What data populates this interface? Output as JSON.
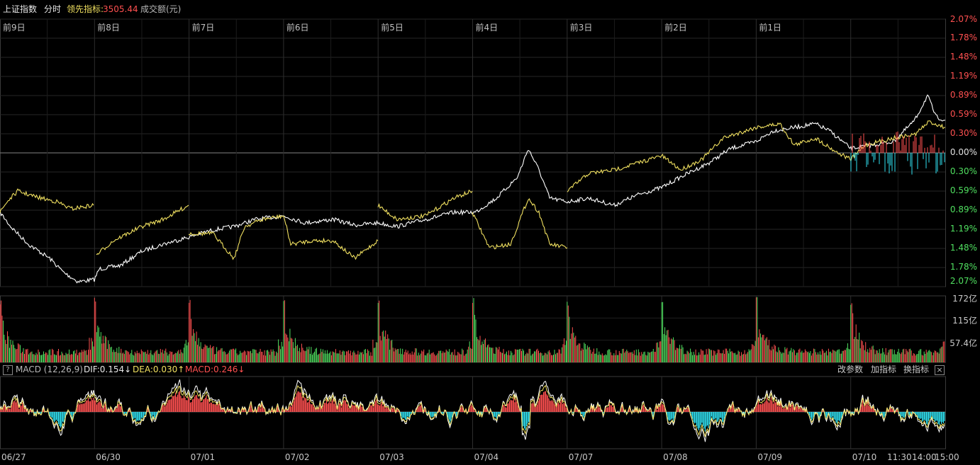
{
  "header": {
    "index_name": "上证指数",
    "mode": "分时",
    "lead_label": "领先指标:",
    "lead_value": "3505.44",
    "volume_unit": "成交额(元)"
  },
  "day_labels": [
    "前9日",
    "前8日",
    "前7日",
    "前6日",
    "前5日",
    "前4日",
    "前3日",
    "前2日",
    "前1日"
  ],
  "pct_labels": [
    {
      "text": "2.07%",
      "color": "#ff5050"
    },
    {
      "text": "1.78%",
      "color": "#ff5050"
    },
    {
      "text": "1.48%",
      "color": "#ff5050"
    },
    {
      "text": "1.19%",
      "color": "#ff5050"
    },
    {
      "text": "0.89%",
      "color": "#ff5050"
    },
    {
      "text": "0.59%",
      "color": "#ff5050"
    },
    {
      "text": "0.30%",
      "color": "#ff5050"
    },
    {
      "text": "0.00%",
      "color": "#e0e0e0"
    },
    {
      "text": "0.30%",
      "color": "#50e060"
    },
    {
      "text": "0.59%",
      "color": "#50e060"
    },
    {
      "text": "0.89%",
      "color": "#50e060"
    },
    {
      "text": "1.19%",
      "color": "#50e060"
    },
    {
      "text": "1.48%",
      "color": "#50e060"
    },
    {
      "text": "1.78%",
      "color": "#50e060"
    },
    {
      "text": "2.07%",
      "color": "#50e060"
    }
  ],
  "volume_labels": [
    "172亿",
    "115亿",
    "57.4亿"
  ],
  "macd": {
    "help": "?",
    "name": "MACD (12,26,9)",
    "dif": "DIF:0.154↓",
    "dea": "DEA:0.030↑",
    "macd": "MACD:0.246↓",
    "tools": [
      "改参数",
      "加指标",
      "换指标"
    ],
    "close": "×"
  },
  "date_labels": [
    "06/27",
    "06/30",
    "07/01",
    "07/02",
    "07/03",
    "07/04",
    "07/07",
    "07/08",
    "07/09",
    "07/10"
  ],
  "time_labels": [
    "11:30",
    "14:00",
    "15:00"
  ],
  "colors": {
    "up": "#ff5050",
    "down": "#50e060",
    "price": "#ffffff",
    "avg": "#f0e060",
    "macd_neg": "#30e0f0"
  }
}
